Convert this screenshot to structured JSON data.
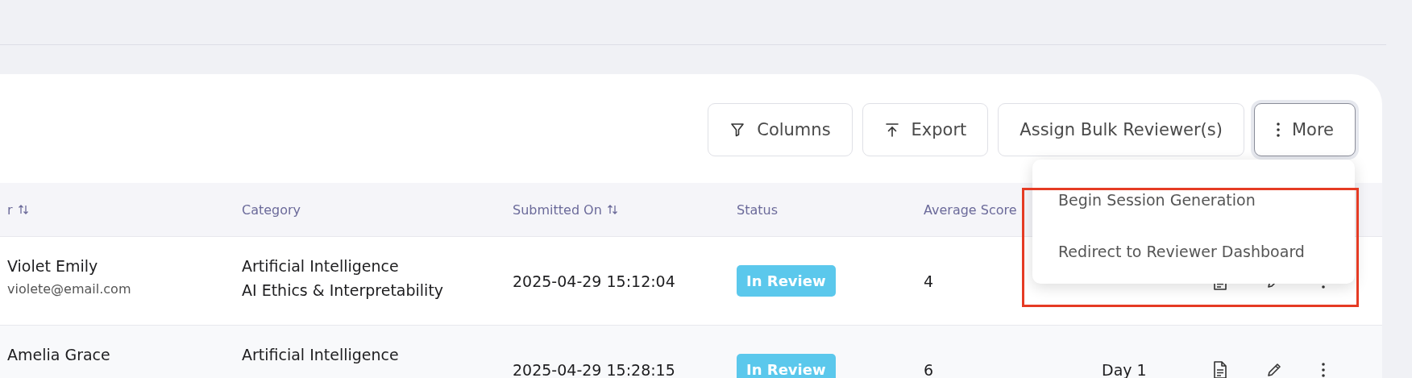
{
  "toolbar": {
    "buttons": [
      {
        "kind": "filter",
        "label": "Columns",
        "focused": false
      },
      {
        "kind": "export",
        "label": "Export",
        "focused": false
      },
      {
        "kind": "plain",
        "label": "Assign Bulk Reviewer(s)",
        "focused": false
      },
      {
        "kind": "more",
        "label": "More",
        "focused": true
      }
    ]
  },
  "menu": {
    "items": [
      "Begin Session Generation",
      "Redirect to Reviewer Dashboard"
    ]
  },
  "table": {
    "columns": [
      {
        "label": "r",
        "sortable": true
      },
      {
        "label": "Category",
        "sortable": false
      },
      {
        "label": "Submitted On",
        "sortable": true
      },
      {
        "label": "Status",
        "sortable": false
      },
      {
        "label": "Average Score",
        "sortable": false
      }
    ],
    "rows": [
      {
        "name": "Violet Emily",
        "email": "violete@email.com",
        "category": [
          "Artificial Intelligence",
          "AI Ethics & Interpretability"
        ],
        "submitted_on": "2025-04-29 15:12:04",
        "status": "In Review",
        "score": "4"
      },
      {
        "name": "Amelia Grace",
        "category": [
          "Artificial Intelligence"
        ],
        "submitted_on": "2025-04-29 15:28:15",
        "status": "In Review",
        "score": "6",
        "day": "Day 1"
      }
    ]
  }
}
